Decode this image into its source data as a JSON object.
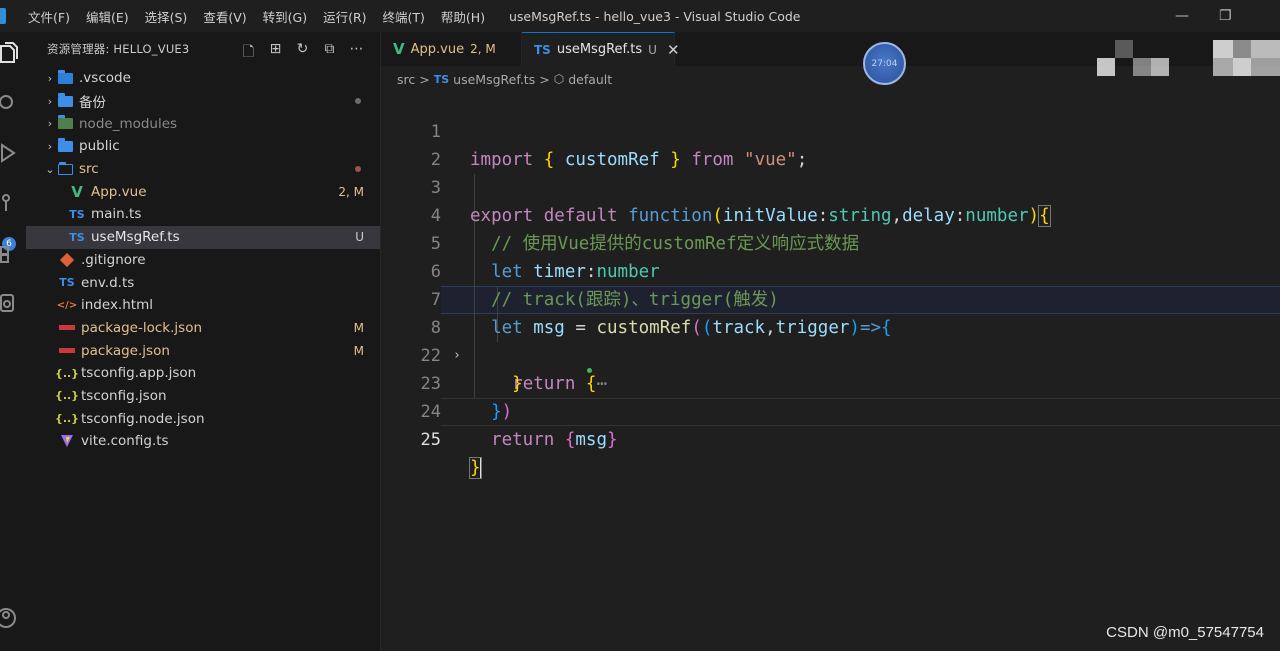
{
  "titlebar": {
    "menu": [
      "文件(F)",
      "编辑(E)",
      "选择(S)",
      "查看(V)",
      "转到(G)",
      "运行(R)",
      "终端(T)",
      "帮助(H)"
    ],
    "title": "useMsgRef.ts - hello_vue3 - Visual Studio Code"
  },
  "activity": {
    "badge_count": "6"
  },
  "explorer": {
    "header": "资源管理器: HELLO_VUE3",
    "items": [
      {
        "label": ".vscode",
        "status": ""
      },
      {
        "label": "备份",
        "status": ""
      },
      {
        "label": "node_modules",
        "status": ""
      },
      {
        "label": "public",
        "status": ""
      },
      {
        "label": "src",
        "status": ""
      },
      {
        "label": "App.vue",
        "status": "2, M"
      },
      {
        "label": "main.ts",
        "status": ""
      },
      {
        "label": "useMsgRef.ts",
        "status": "U"
      },
      {
        "label": ".gitignore",
        "status": ""
      },
      {
        "label": "env.d.ts",
        "status": ""
      },
      {
        "label": "index.html",
        "status": ""
      },
      {
        "label": "package-lock.json",
        "status": "M"
      },
      {
        "label": "package.json",
        "status": "M"
      },
      {
        "label": "tsconfig.app.json",
        "status": ""
      },
      {
        "label": "tsconfig.json",
        "status": ""
      },
      {
        "label": "tsconfig.node.json",
        "status": ""
      },
      {
        "label": "vite.config.ts",
        "status": ""
      }
    ]
  },
  "tabs": [
    {
      "label": "App.vue",
      "status": "2, M",
      "icon": "V"
    },
    {
      "label": "useMsgRef.ts",
      "status": "U",
      "icon": "TS"
    }
  ],
  "breadcrumb": {
    "part1": "src",
    "sep": ">",
    "icon": "TS",
    "part2": "useMsgRef.ts",
    "part3": "default"
  },
  "editor": {
    "line_numbers": [
      "1",
      "2",
      "3",
      "4",
      "5",
      "6",
      "7",
      "8",
      "22",
      "23",
      "24",
      "25"
    ],
    "fold_marker": "⋯"
  },
  "overlay": {
    "avatar_text": "27:04"
  },
  "watermark": "CSDN @m0_57547754",
  "colors": {
    "accent": "#0078d4",
    "vue_green": "#41b883",
    "ts_blue": "#3178c6",
    "modified": "#e2c08d",
    "untracked": "#73c991"
  }
}
